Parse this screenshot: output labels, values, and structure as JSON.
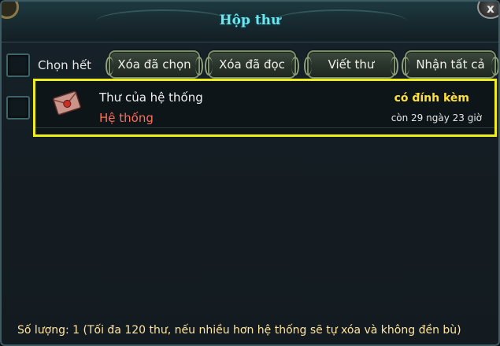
{
  "window": {
    "title": "Hộp thư",
    "close_label": "x"
  },
  "toolbar": {
    "select_all_label": "Chọn hết",
    "delete_selected_label": "Xóa đã chọn",
    "delete_read_label": "Xóa đã đọc",
    "write_label": "Viết thư",
    "receive_all_label": "Nhận tất cả"
  },
  "mails": [
    {
      "subject": "Thư của hệ thống",
      "sender": "Hệ thống",
      "attachment": "có đính kèm",
      "expire": "còn 29 ngày 23 giờ",
      "icon": "letter-icon",
      "selected": true
    }
  ],
  "footer": {
    "count_text": "Số lượng: 1 (Tối đa 120 thư, nếu nhiều hơn hệ thống sẽ tự xóa và không đền bù)"
  },
  "colors": {
    "title": "#6fe6f0",
    "sender": "#ff6e5a",
    "attachment": "#ffe13a",
    "highlight": "#f0ee1a",
    "footer": "#ffe5a0"
  }
}
